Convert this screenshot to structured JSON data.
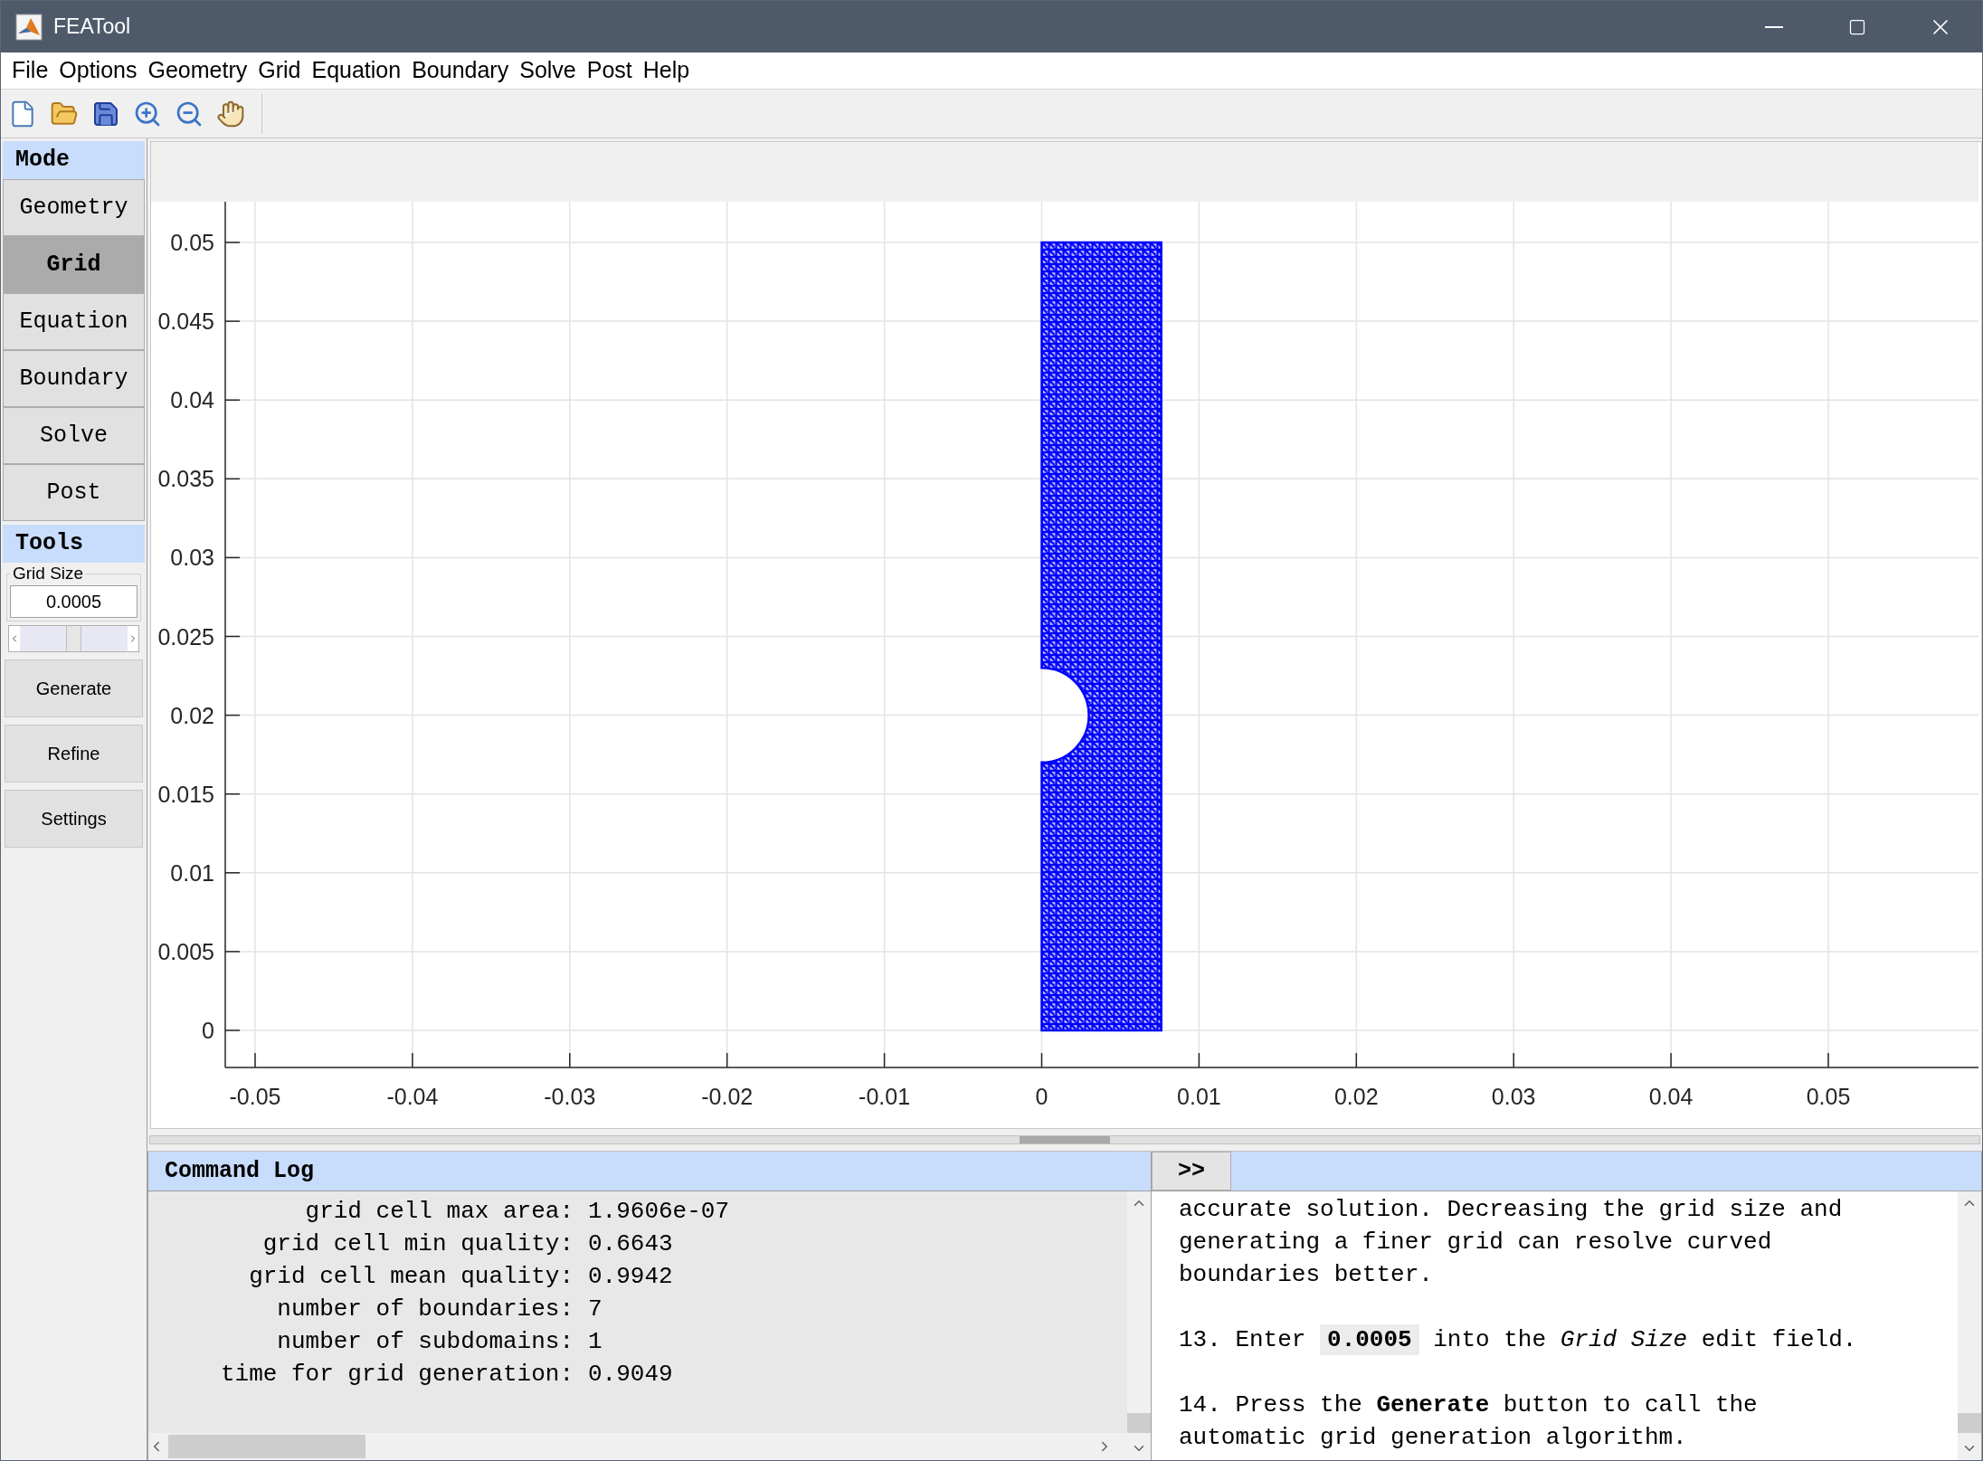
{
  "window": {
    "title": "FEATool"
  },
  "menu": [
    "File",
    "Options",
    "Geometry",
    "Grid",
    "Equation",
    "Boundary",
    "Solve",
    "Post",
    "Help"
  ],
  "mode_panel": {
    "title": "Mode",
    "items": [
      {
        "label": "Geometry",
        "selected": false
      },
      {
        "label": "Grid",
        "selected": true
      },
      {
        "label": "Equation",
        "selected": false
      },
      {
        "label": "Boundary",
        "selected": false
      },
      {
        "label": "Solve",
        "selected": false
      },
      {
        "label": "Post",
        "selected": false
      }
    ]
  },
  "tools_panel": {
    "title": "Tools",
    "grid_size": {
      "label": "Grid Size",
      "value": "0.0005"
    },
    "slider": {
      "level": 0.5
    },
    "buttons": [
      "Generate",
      "Refine",
      "Settings"
    ]
  },
  "plot": {
    "xticks": [
      "-0.05",
      "-0.04",
      "-0.03",
      "-0.02",
      "-0.01",
      "0",
      "0.01",
      "0.02",
      "0.03",
      "0.04",
      "0.05"
    ],
    "yticks": [
      "0.05",
      "0.045",
      "0.04",
      "0.035",
      "0.03",
      "0.025",
      "0.02",
      "0.015",
      "0.01",
      "0.005",
      "0"
    ]
  },
  "command_log": {
    "title": "Command Log",
    "lines": [
      {
        "label": "grid cell max area:",
        "value": "1.9606e-07"
      },
      {
        "label": "grid cell min quality:",
        "value": "0.6643"
      },
      {
        "label": "grid cell mean quality:",
        "value": "0.9942"
      },
      {
        "label": "number of boundaries:",
        "value": "7"
      },
      {
        "label": "number of subdomains:",
        "value": "1"
      },
      {
        "label": "time for grid generation:",
        "value": "0.9049"
      }
    ]
  },
  "help": {
    "button": ">>",
    "paragraphs": [
      {
        "kind": "plain",
        "text": "accurate solution. Decreasing the grid size and generating a finer grid can resolve curved boundaries better."
      },
      {
        "kind": "inline-code",
        "text": "13. Enter **0.0005** into the *Grid Size* edit field."
      },
      {
        "kind": "plain",
        "text": "14. Press the **Generate** button to call the automatic grid generation algorithm."
      }
    ]
  }
}
